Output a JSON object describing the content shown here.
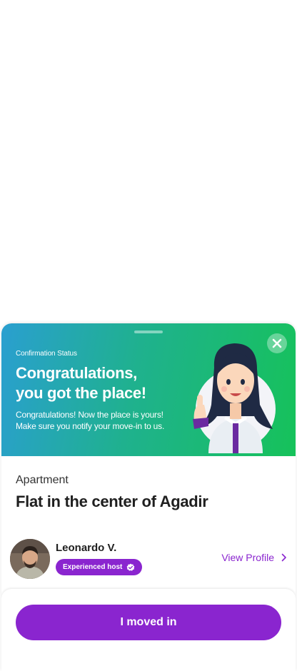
{
  "banner": {
    "status_label": "Confirmation Status",
    "headline_line1": "Congratulations,",
    "headline_line2": "you got the place!",
    "message_line1": "Congratulations! Now the place is yours!",
    "message_line2": "Make sure you notify your move-in to us.",
    "close_icon": "close-icon",
    "illustration": "woman-thumbs-up-illustration"
  },
  "listing": {
    "category": "Apartment",
    "title": "Flat in the center of Agadir"
  },
  "host": {
    "name": "Leonardo V.",
    "badge": "Experienced host",
    "badge_icon": "verified-check-icon",
    "view_profile_label": "View Profile"
  },
  "action": {
    "primary_label": "I moved in"
  },
  "colors": {
    "brand_purple": "#8a25cf",
    "banner_gradient_start": "#2a9fd0",
    "banner_gradient_end": "#16c25a"
  }
}
